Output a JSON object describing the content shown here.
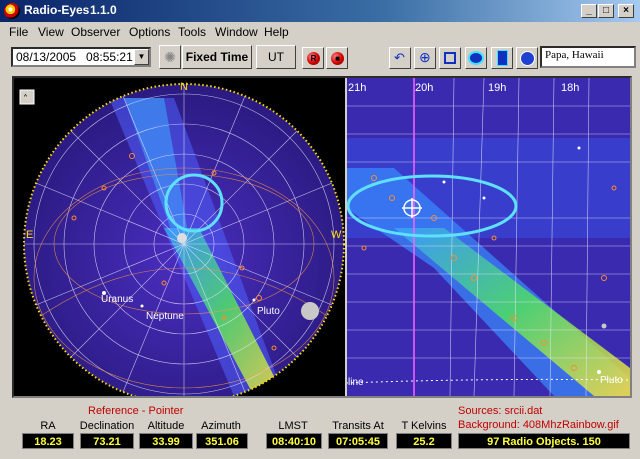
{
  "window": {
    "title": "Radio-Eyes",
    "version": "1.1.0"
  },
  "menu": [
    "File",
    "View",
    "Observer",
    "Options",
    "Tools",
    "Window",
    "Help"
  ],
  "toolbar": {
    "datetime": "08/13/2005   08:55:21",
    "fixed_time_label": "Fixed Time",
    "ut_label": "UT",
    "location": "Papa, Hawaii"
  },
  "sky": {
    "dome_labels": {
      "n": "N",
      "e": "E",
      "w": "W"
    },
    "dome_objects": [
      "Uranus",
      "Neptune",
      "Pluto"
    ],
    "ra_ticks": [
      "21h",
      "20h",
      "19h",
      "18h"
    ],
    "flat_labels": [
      "Pluto",
      "line"
    ],
    "colors": {
      "background": "#2e1d86",
      "accent_cyan": "#5fe0ff",
      "grid": "#e8e8ff",
      "horizon": "#ffdd00",
      "meridian": "#ff60ff"
    }
  },
  "status": {
    "reference_label": "Reference - Pointer",
    "columns": [
      {
        "label": "RA",
        "value": "18.23"
      },
      {
        "label": "Declination",
        "value": "73.21"
      },
      {
        "label": "Altitude",
        "value": "33.99"
      },
      {
        "label": "Azimuth",
        "value": "351.06"
      },
      {
        "label": "LMST",
        "value": "08:40:10"
      },
      {
        "label": "Transits At",
        "value": "07:05:45"
      },
      {
        "label": "T Kelvins",
        "value": "25.2"
      }
    ],
    "sources": "Sources: srcii.dat",
    "background": "Background: 408MhzRainbow.gif",
    "objects": "97 Radio Objects.   150"
  }
}
